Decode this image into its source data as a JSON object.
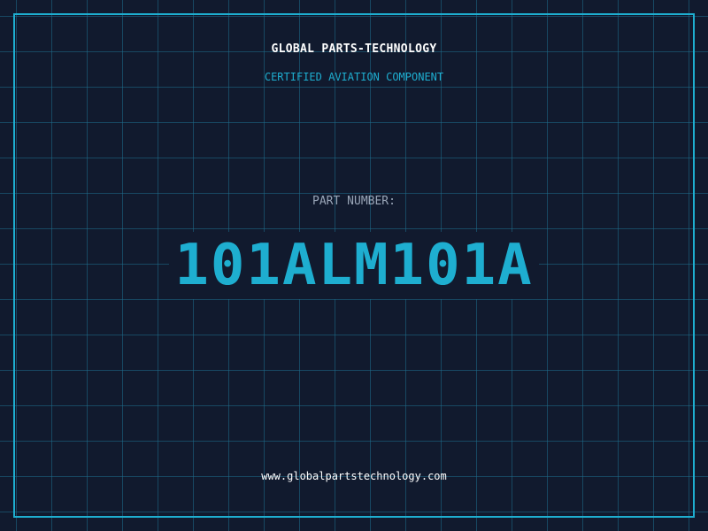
{
  "header": {
    "company": "GLOBAL PARTS-TECHNOLOGY",
    "certification": "CERTIFIED AVIATION COMPONENT"
  },
  "part": {
    "label": "PART NUMBER:",
    "number": "101ALM101A"
  },
  "footer": {
    "url": "www.globalpartstechnology.com"
  },
  "colors": {
    "background": "#111a2e",
    "accent": "#1eaed0",
    "grid": "#1e6e8c",
    "title_text": "#ffffff",
    "label_text": "#9aa6b8"
  }
}
